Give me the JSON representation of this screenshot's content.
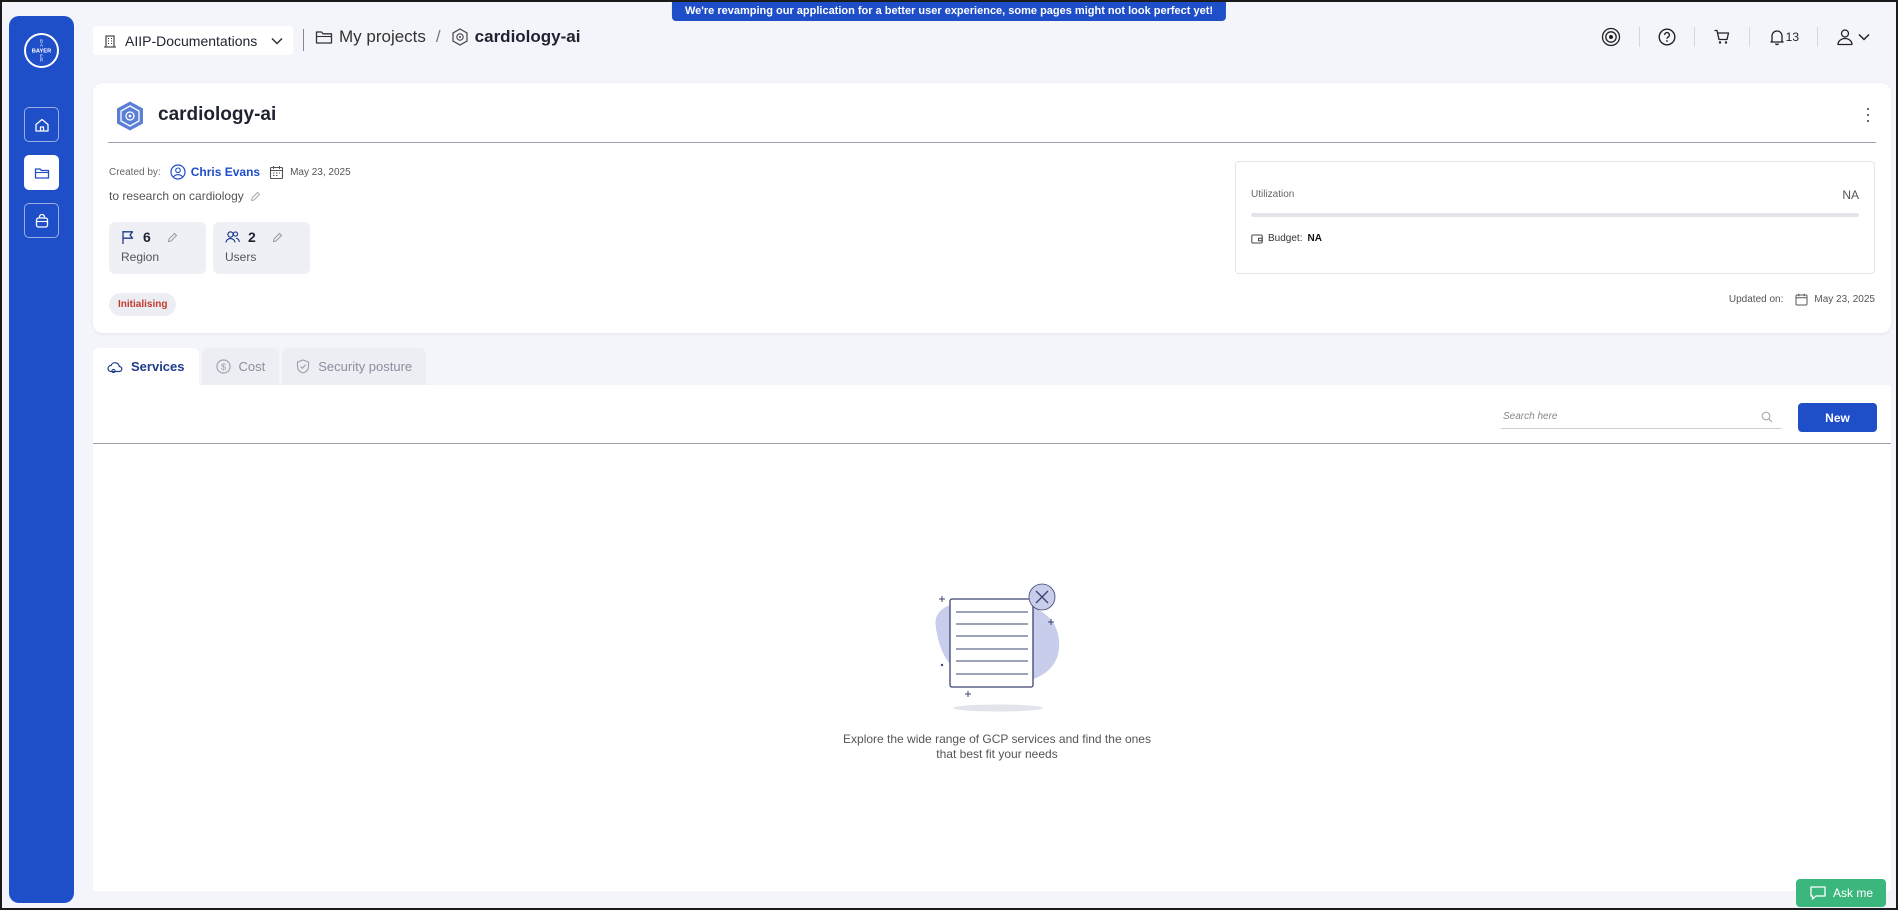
{
  "banner": {
    "text": "We're revamping our application for a better user experience, some pages might not look perfect yet!"
  },
  "sidebar": {
    "logo_text": "BAYER",
    "items": [
      {
        "name": "home",
        "icon": "home-icon",
        "active": false
      },
      {
        "name": "projects",
        "icon": "folder-icon",
        "active": true
      },
      {
        "name": "shop",
        "icon": "bag-icon",
        "active": false
      }
    ]
  },
  "header": {
    "org": "AIIP-Documentations",
    "breadcrumb": {
      "parent": "My projects",
      "current": "cardiology-ai"
    },
    "notifications_count": "13"
  },
  "project": {
    "title": "cardiology-ai",
    "created_by_label": "Created by:",
    "author": "Chris Evans",
    "created_date": "May 23, 2025",
    "description": "to research on cardiology",
    "region": {
      "value": "6",
      "label": "Region"
    },
    "users": {
      "value": "2",
      "label": "Users"
    },
    "status": "Initialising",
    "utilization": {
      "label": "Utilization",
      "value": "NA",
      "fill_percent": 0
    },
    "budget": {
      "label": "Budget:",
      "value": "NA"
    },
    "updated_label": "Updated on:",
    "updated_date": "May 23, 2025"
  },
  "tabs": [
    {
      "label": "Services",
      "icon": "cloud-icon",
      "active": true
    },
    {
      "label": "Cost",
      "icon": "dollar-icon",
      "active": false
    },
    {
      "label": "Security posture",
      "icon": "shield-icon",
      "active": false
    }
  ],
  "services": {
    "search": {
      "placeholder": "Search here",
      "value": ""
    },
    "new_button": "New",
    "empty_line1": "Explore the wide range of GCP services and find the ones",
    "empty_line2": "that best fit your needs"
  },
  "ask_me": {
    "label": "Ask me"
  },
  "colors": {
    "primary": "#1f4ec9",
    "status_text": "#c13a2a",
    "ask_me": "#3bb77e"
  }
}
